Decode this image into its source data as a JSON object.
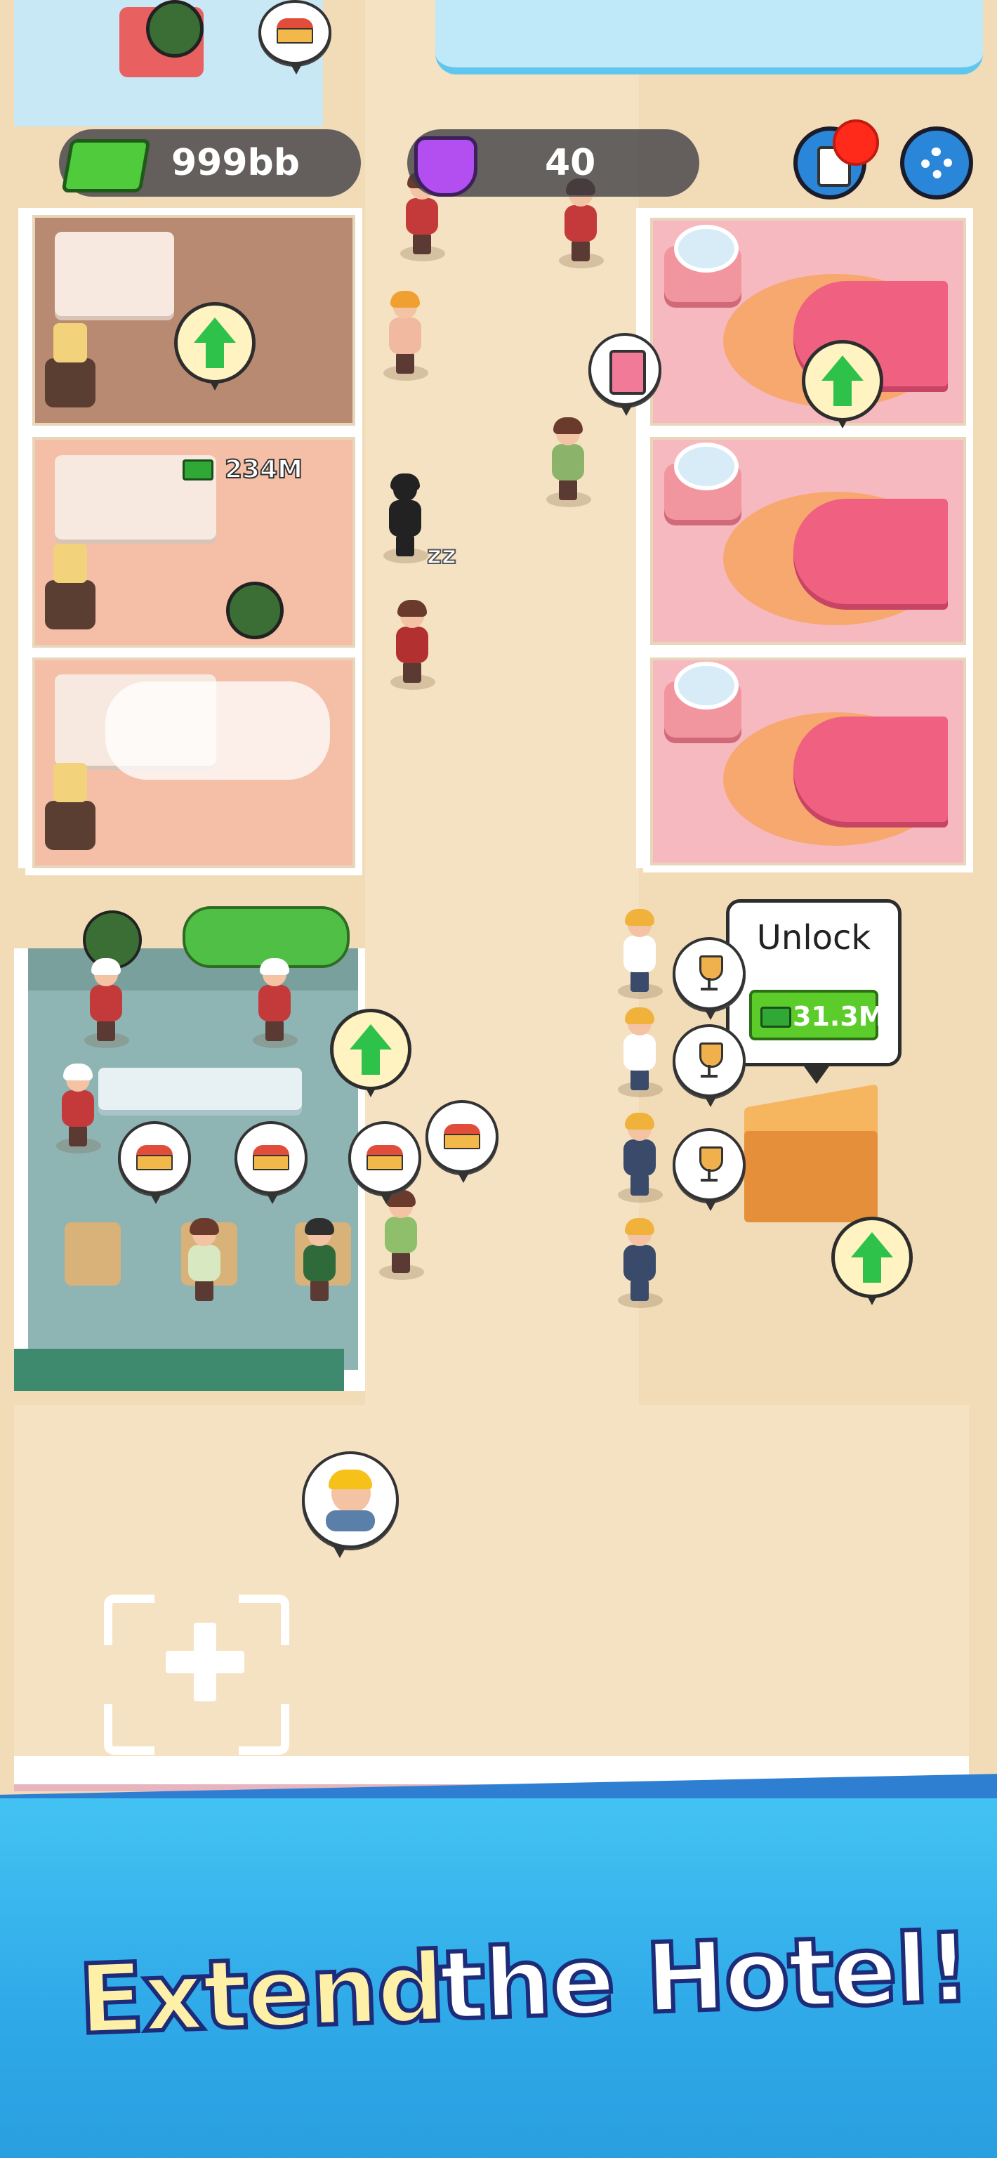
{
  "hud": {
    "cash_value": "999bb",
    "gem_value": "40",
    "cash_icon": "cash-stack-icon",
    "gem_icon": "purple-gem-icon",
    "tasks_icon": "clipboard-checklist-icon",
    "settings_icon": "gear-icon"
  },
  "rooms": {
    "room_2_price": "234M"
  },
  "unlock": {
    "title": "Unlock",
    "price": "31.3M"
  },
  "banner": {
    "text_part1": "Extend",
    "text_part2": "the Hotel!"
  },
  "colors": {
    "accent_green": "#2ec24a",
    "banner_blue": "#2fa9e8",
    "banner_text": "#fff0a8",
    "notification_red": "#ff2a1a"
  }
}
